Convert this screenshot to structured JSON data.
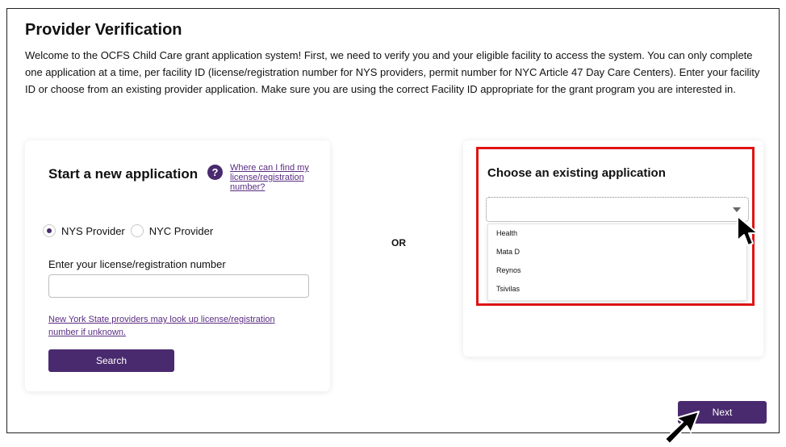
{
  "page": {
    "title": "Provider Verification",
    "intro": "Welcome to the OCFS Child Care grant application system! First, we need to verify you and your eligible facility to access the system. You can only complete one application at a time, per facility ID (license/registration number for NYS providers, permit number for NYC Article 47 Day Care Centers). Enter your facility ID or choose from an existing provider application. Make sure you are using the correct Facility ID appropriate for the grant program you are interested in."
  },
  "new_application": {
    "title": "Start a new application",
    "help_icon": "?",
    "help_link": "Where can I find my license/registration number?",
    "radio_options": [
      {
        "label": "NYS Provider",
        "checked": true
      },
      {
        "label": "NYC Provider",
        "checked": false
      }
    ],
    "field_label": "Enter your license/registration number",
    "field_value": "",
    "lookup_link": "New York State providers may look up license/registration number if unknown.",
    "search_label": "Search"
  },
  "separator": "OR",
  "existing_application": {
    "title": "Choose an existing application",
    "selected_value": "",
    "options": [
      "Health",
      "Mata D",
      "Reynos",
      "Tsivilas"
    ]
  },
  "next_label": "Next",
  "colors": {
    "primary": "#4a2a6e",
    "highlight": "#e01414",
    "link": "#5a2d82"
  }
}
